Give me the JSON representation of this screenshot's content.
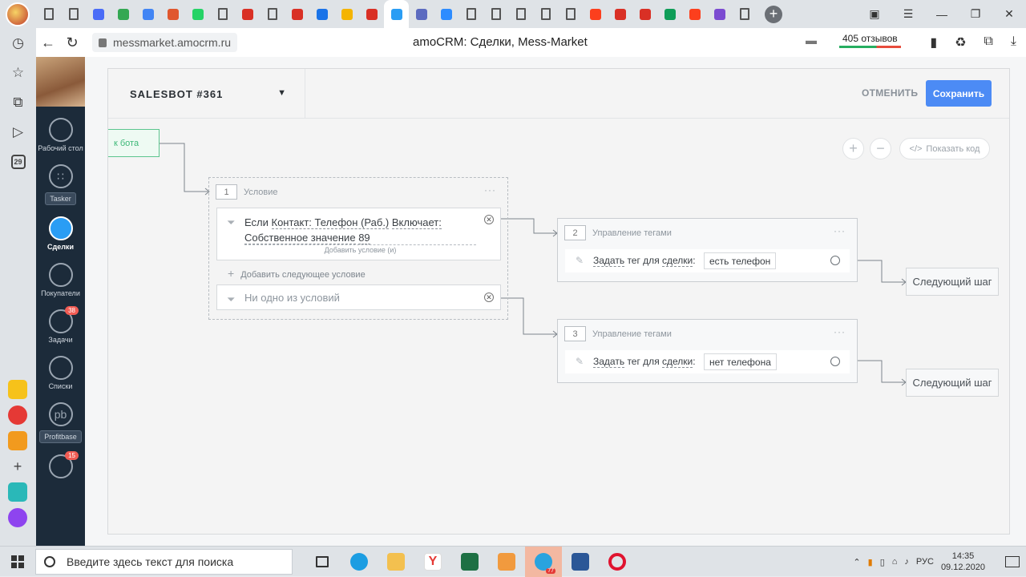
{
  "browser": {
    "url": "messmarket.amocrm.ru",
    "page_title": "amoCRM: Сделки, Mess-Market",
    "reviews_label": "405 отзывов",
    "tabs": [
      {
        "icon": "doc",
        "color": "#555"
      },
      {
        "icon": "doc",
        "color": "#555"
      },
      {
        "icon": "c",
        "color": "#4a6cf7"
      },
      {
        "icon": "chrome",
        "color": "#34a853"
      },
      {
        "icon": "docs",
        "color": "#4285f4"
      },
      {
        "icon": "bars",
        "color": "#e0572e"
      },
      {
        "icon": "whatsapp",
        "color": "#25d366"
      },
      {
        "icon": "doc",
        "color": "#555"
      },
      {
        "icon": "acrobat",
        "color": "#d93025"
      },
      {
        "icon": "doc",
        "color": "#555"
      },
      {
        "icon": "pdf",
        "color": "#d93025"
      },
      {
        "icon": "mail",
        "color": "#1a73e8"
      },
      {
        "icon": "image",
        "color": "#f4b400"
      },
      {
        "icon": "a",
        "color": "#d93025"
      },
      {
        "icon": "amo",
        "color": "#2a9df4",
        "active": true
      },
      {
        "icon": "bolt",
        "color": "#5c6bc0"
      },
      {
        "icon": "zoom",
        "color": "#2d8cff"
      },
      {
        "icon": "doc",
        "color": "#555"
      },
      {
        "icon": "doc",
        "color": "#555"
      },
      {
        "icon": "doc",
        "color": "#555"
      },
      {
        "icon": "doc",
        "color": "#555"
      },
      {
        "icon": "doc",
        "color": "#555"
      },
      {
        "icon": "yandex",
        "color": "#fc3f1d"
      },
      {
        "icon": "gmail",
        "color": "#d93025"
      },
      {
        "icon": "gmail",
        "color": "#d93025"
      },
      {
        "icon": "drive",
        "color": "#0f9d58"
      },
      {
        "icon": "yandex",
        "color": "#fc3f1d"
      },
      {
        "icon": "onec",
        "color": "#7b4bd1"
      },
      {
        "icon": "doc",
        "color": "#555"
      }
    ],
    "sidebar_date": "29"
  },
  "amo": {
    "nav": [
      {
        "label": "Рабочий стол",
        "icon": "dashboard-icon"
      },
      {
        "label": "Tasker",
        "icon": "apps-grid-icon",
        "chip": true
      },
      {
        "label": "Сделки",
        "icon": "deals-icon",
        "active": true
      },
      {
        "label": "Покупатели",
        "icon": "customers-icon"
      },
      {
        "label": "Задачи",
        "icon": "tasks-icon",
        "badge": "38"
      },
      {
        "label": "Списки",
        "icon": "lists-icon"
      },
      {
        "label": "Profitbase",
        "icon": "profitbase-icon",
        "chip": true
      },
      {
        "label": "",
        "icon": "chat-icon",
        "badge": "15"
      }
    ],
    "tasker_glyph": "∷",
    "profitbase_glyph": "pb"
  },
  "modal": {
    "bot_name": "SALESBOT #361",
    "cancel_label": "ОТМЕНИТЬ",
    "save_label": "Сохранить",
    "zoom_in": "+",
    "zoom_out": "−",
    "show_code": "Показать код",
    "code_glyph": "</>",
    "start_node_label": "к бота",
    "condition_node": {
      "number": "1",
      "title": "Условие",
      "dots": "···",
      "rule_prefix": "Если",
      "rule_field": "Контакт: Телефон (Раб.)",
      "rule_operator": "Включает:",
      "rule_value": "Собственное значение",
      "rule_value_num": "89",
      "add_sub_condition": "Добавить условие (и)",
      "add_next_condition": "Добавить следующее условие",
      "otherwise": "Ни одно из условий"
    },
    "tag_nodes": [
      {
        "number": "2",
        "title": "Управление тегами",
        "action_verb": "Задать",
        "action_rest": "тег для",
        "action_target": "сделки",
        "tag": "есть телефон",
        "next_label": "Следующий шаг"
      },
      {
        "number": "3",
        "title": "Управление тегами",
        "action_verb": "Задать",
        "action_rest": "тег для",
        "action_target": "сделки",
        "tag": "нет телефона",
        "next_label": "Следующий шаг"
      }
    ]
  },
  "taskbar": {
    "search_placeholder": "Введите здесь текст для поиска",
    "lang": "РУС",
    "time": "14:35",
    "date": "09.12.2020",
    "telegram_badge": "77"
  }
}
